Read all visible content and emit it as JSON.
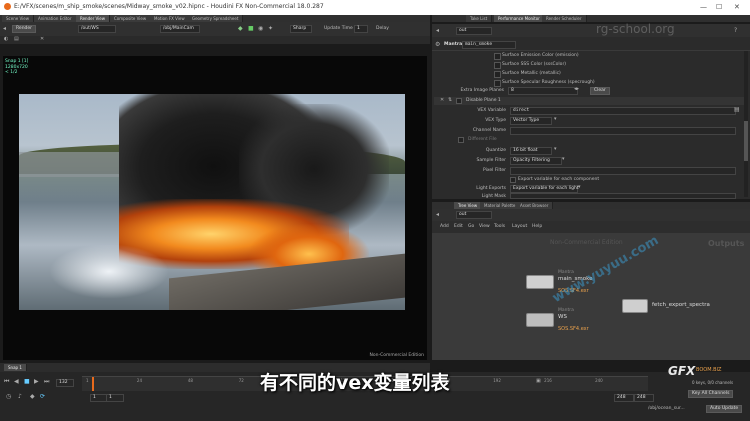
{
  "window": {
    "title": "E:/VFX/scenes/m_ship_smoke/scenes/Midway_smoke_v02.hipnc - Houdini FX Non-Commercial 18.0.287",
    "minimize_glyph": "—",
    "maximize_glyph": "☐",
    "close_glyph": "✕"
  },
  "left_tabs": [
    "Scene View",
    "Animation Editor",
    "Render View",
    "Composite View",
    "Motion FX View",
    "Geometry Spreadsheet"
  ],
  "viewer_toolbar": {
    "render_btn": "Render",
    "path": "/out/WS",
    "camera": "/obj/MainCam",
    "snapshot_mode": "Sharp",
    "update_time": "Update Time",
    "update_value": "1",
    "delay": "Delay"
  },
  "viewer": {
    "snap_label": "Snap 1 [1]",
    "info_line1": "1280x720",
    "info_line2": "< 1/2",
    "watermark": "Non-Commercial Edition",
    "snapshot_tab": "Snap 1"
  },
  "right_tabs": [
    "Take List",
    "Performance Monitor",
    "Render Scheduler"
  ],
  "param_path": "out",
  "site_watermark": "rg-school.org",
  "param_header": {
    "node_type": "Mantra",
    "node_name": "main_smoke"
  },
  "param_checks": [
    "Surface Emission Color (emission)",
    "Surface SSS Color (sssColor)",
    "Surface Metallic (metallic)",
    "Surface Specular Roughness (specrough)"
  ],
  "params": {
    "extra_planes_label": "Extra Image Planes",
    "extra_planes_value": "8",
    "clear_btn": "Clear",
    "disable_plane": "Disable Plane 1",
    "vex_var_label": "VEX Variable",
    "vex_var_value": "direct",
    "vex_type_label": "VEX Type",
    "vex_type_value": "Vector Type",
    "channel_name_label": "Channel Name",
    "channel_name_value": "",
    "different_file_label": "Different File",
    "quantize_label": "Quantize",
    "quantize_value": "16 bit float",
    "sample_filter_label": "Sample Filter",
    "sample_filter_value": "Opacity Filtering",
    "pixel_filter_label": "Pixel Filter",
    "pixel_filter_value": "",
    "export_each_component": "Export variable for each component",
    "light_exports_label": "Light Exports",
    "light_exports_value": "Export variable for each light",
    "light_mask_label": "Light Mask",
    "light_mask_value": ""
  },
  "network_tabs": [
    "Tree View",
    "Material Palette",
    "Asset Browser"
  ],
  "network_path": "out",
  "network_menu": [
    "Add",
    "Edit",
    "Go",
    "View",
    "Tools",
    "Layout",
    "Help"
  ],
  "network_watermark": "Non-Commercial Edition",
  "network_title": "Outputs",
  "nodes": [
    {
      "type": "Mantra",
      "name": "main_smoke",
      "output": "SOS.SF4.exr"
    },
    {
      "type": "Mantra",
      "name": "WS",
      "output": "SOS.SF4.exr"
    },
    {
      "type": "",
      "name": "fetch_export_spectra",
      "output": ""
    }
  ],
  "timeline": {
    "marks": [
      "1",
      "24",
      "48",
      "72",
      "96",
      "120",
      "144",
      "168",
      "192",
      "216",
      "240"
    ],
    "current_frame": "132",
    "start": "1",
    "start2": "1",
    "end": "248",
    "end2": "248",
    "keys_info": "0 keys, 0/0 channels",
    "key_all": "Key All Channels",
    "path": "/obj/ocean_sur...",
    "auto_update": "Auto Update"
  },
  "subtitle": "有不同的vex变量列表",
  "brand": {
    "logo": "GFX",
    "logo_sub": "BOOM.BIZ",
    "site": "www.yuyuu.com"
  },
  "colors": {
    "accent_orange": "#e8a04c",
    "panel": "#2b2b2b",
    "field": "#262626"
  }
}
